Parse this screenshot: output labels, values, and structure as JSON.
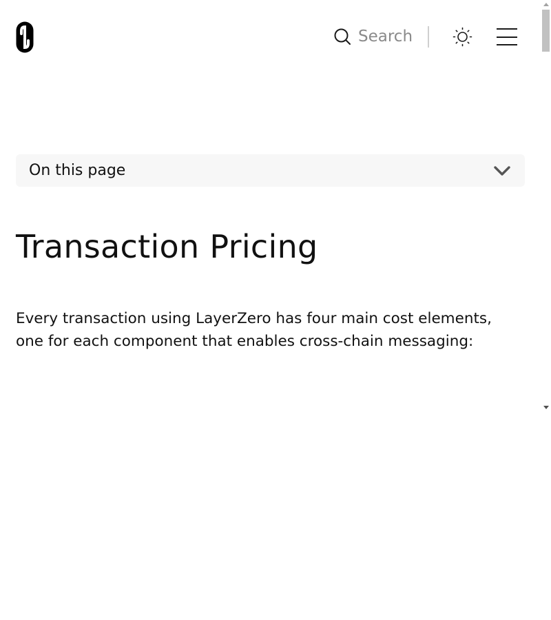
{
  "header": {
    "logo_name": "LayerZero",
    "search": {
      "placeholder": "Search",
      "icon": "search-icon"
    },
    "theme_toggle_icon": "sun-icon",
    "menu_icon": "hamburger-menu-icon"
  },
  "toc": {
    "label": "On this page",
    "icon": "chevron-down-icon"
  },
  "content": {
    "title": "Transaction Pricing",
    "intro": "Every transaction using LayerZero has four main cost elements, one for each component that enables cross-chain messaging:"
  },
  "colors": {
    "text": "#111111",
    "muted": "#8a8a8a",
    "toc_background": "#f7f7f7",
    "divider": "#cfcfcf"
  }
}
